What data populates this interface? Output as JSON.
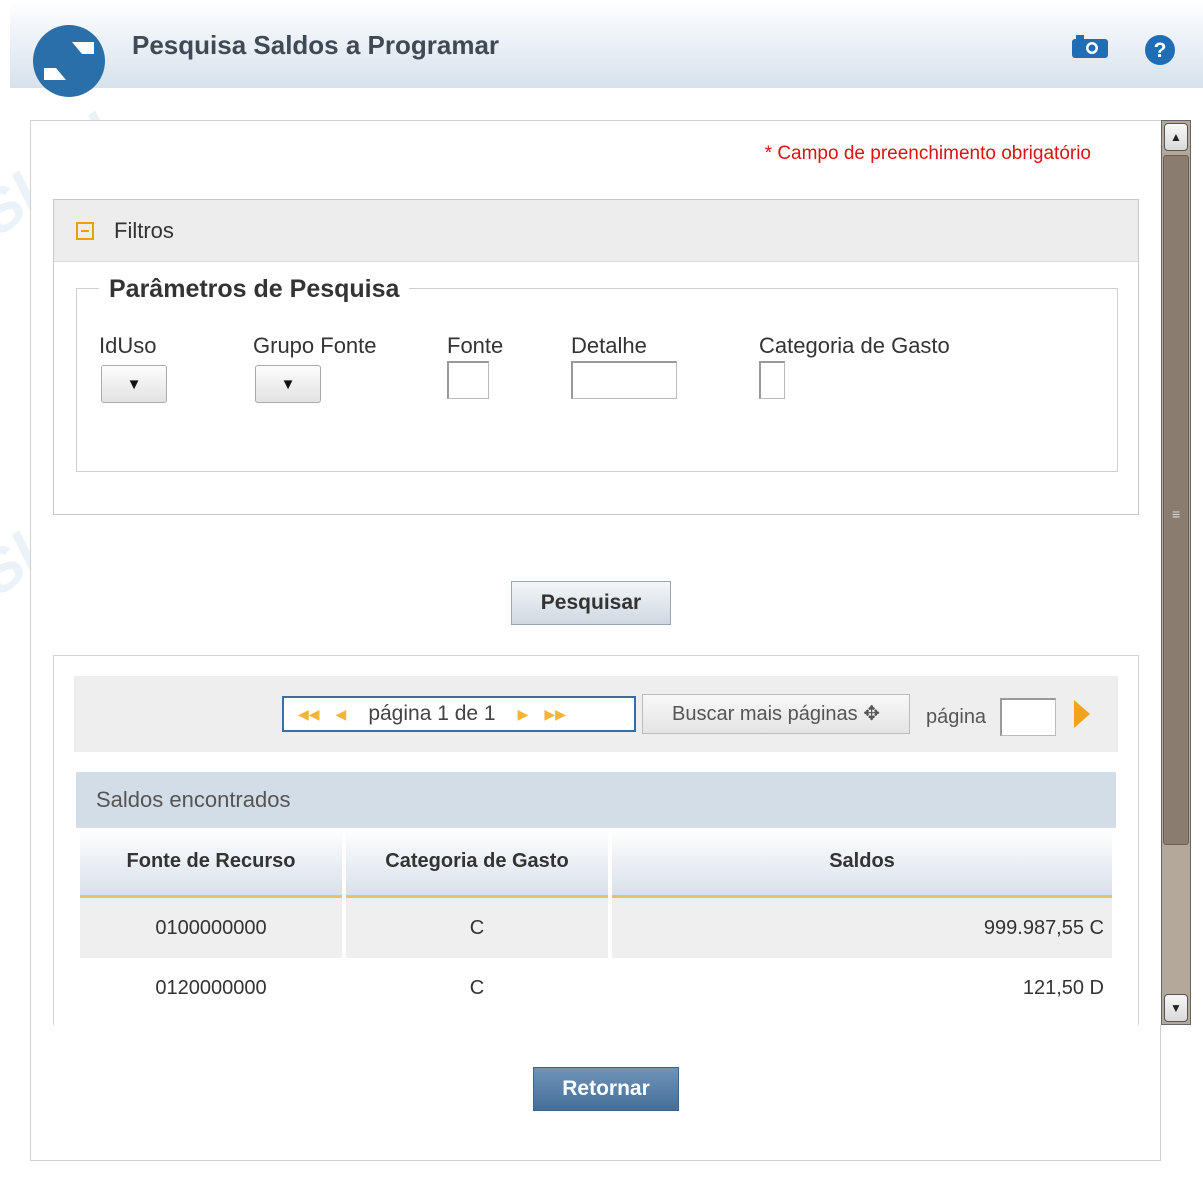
{
  "header": {
    "title": "Pesquisa Saldos a Programar",
    "logo_icon": "siafi-logo-icon",
    "camera_icon": "camera-icon",
    "help_icon": "help-icon"
  },
  "form": {
    "required_note": "* Campo de preenchimento obrigatório",
    "filters_label": "Filtros",
    "params_legend": "Parâmetros de Pesquisa",
    "fields": {
      "iduso": "IdUso",
      "grupo_fonte": "Grupo Fonte",
      "fonte": "Fonte",
      "detalhe": "Detalhe",
      "categoria_gasto": "Categoria de Gasto"
    },
    "select_arrow": "▼",
    "search_button": "Pesquisar"
  },
  "pager": {
    "first": "◀◀",
    "prev": "◀",
    "text": "página 1 de 1",
    "next": "▶",
    "last": "▶▶",
    "more_pages": "Buscar mais páginas ✥",
    "page_label": "página"
  },
  "results": {
    "title": "Saldos encontrados",
    "columns": [
      "Fonte de Recurso",
      "Categoria de Gasto",
      "Saldos"
    ],
    "rows": [
      {
        "fonte": "0100000000",
        "categoria": "C",
        "saldo": "999.987,55 C"
      },
      {
        "fonte": "0120000000",
        "categoria": "C",
        "saldo": "121,50 D"
      }
    ]
  },
  "footer": {
    "return_button": "Retornar"
  },
  "watermark": "SIAFI",
  "colors": {
    "required": "#dd1111",
    "primary_button": "#456f99",
    "accent": "#f2a31d"
  }
}
